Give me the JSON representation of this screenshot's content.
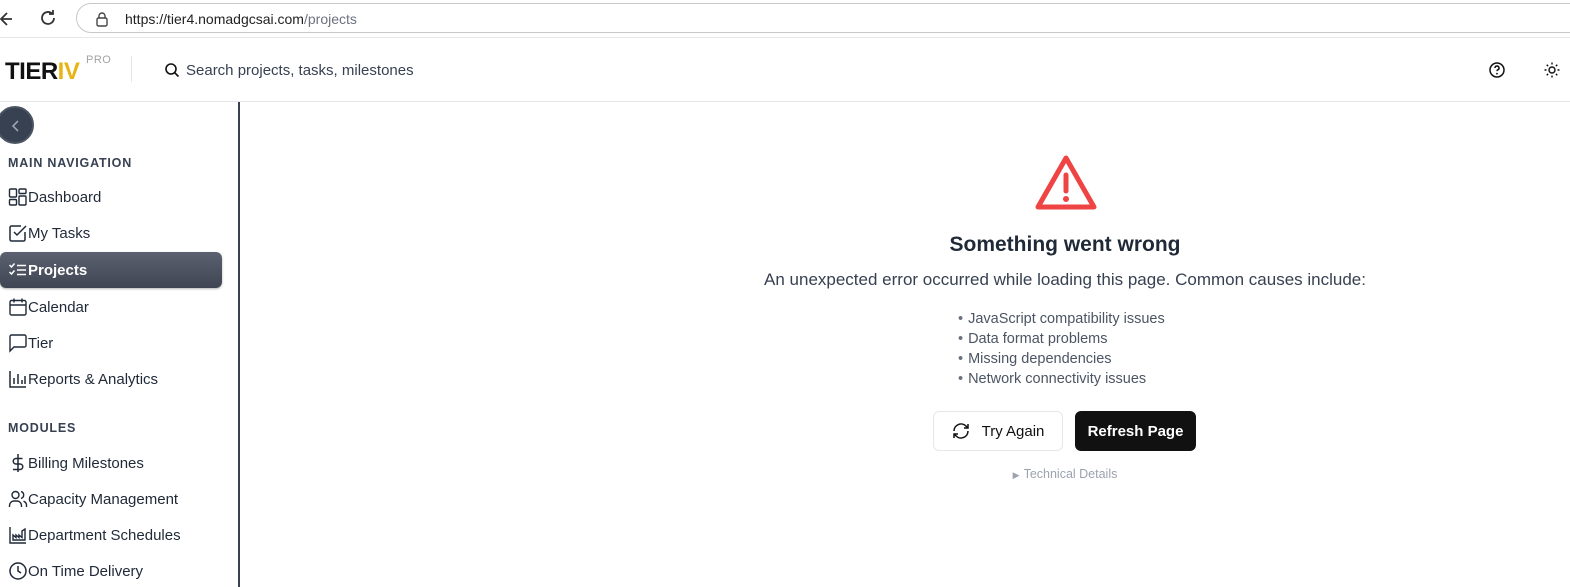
{
  "browser": {
    "url_host": "https://tier4.nomadgcsai.com",
    "url_path": "/projects"
  },
  "header": {
    "logo_main": "TIER",
    "logo_accent": "IV",
    "logo_badge": "PRO",
    "search_placeholder": "Search projects, tasks, milestones"
  },
  "sidebar": {
    "section_main": "MAIN NAVIGATION",
    "main_items": [
      {
        "label": "Dashboard",
        "icon": "dashboard-icon"
      },
      {
        "label": "My Tasks",
        "icon": "checkbox-icon"
      },
      {
        "label": "Projects",
        "icon": "list-checks-icon",
        "active": true
      },
      {
        "label": "Calendar",
        "icon": "calendar-icon"
      },
      {
        "label": "Tier",
        "icon": "chat-icon"
      },
      {
        "label": "Reports & Analytics",
        "icon": "bar-chart-icon"
      }
    ],
    "section_modules": "MODULES",
    "module_items": [
      {
        "label": "Billing Milestones",
        "icon": "dollar-icon"
      },
      {
        "label": "Capacity Management",
        "icon": "users-icon"
      },
      {
        "label": "Department Schedules",
        "icon": "factory-chart-icon"
      },
      {
        "label": "On Time Delivery",
        "icon": "clock-icon"
      }
    ]
  },
  "error": {
    "title": "Something went wrong",
    "description": "An unexpected error occurred while loading this page. Common causes include:",
    "causes": [
      "JavaScript compatibility issues",
      "Data format problems",
      "Missing dependencies",
      "Network connectivity issues"
    ],
    "try_again_label": "Try Again",
    "refresh_label": "Refresh Page",
    "technical_details_label": "Technical Details"
  },
  "colors": {
    "accent": "#e7b416",
    "warning": "#ef4444",
    "active_nav": "#4b5160",
    "primary_button": "#111111"
  }
}
